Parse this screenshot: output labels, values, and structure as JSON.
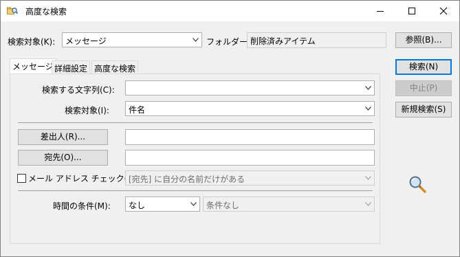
{
  "window": {
    "title": "高度な検索",
    "controls": {
      "minimize": "minimize",
      "maximize": "maximize",
      "close": "close"
    }
  },
  "top": {
    "search_target_label": "検索対象(K):",
    "search_target_value": "メッセージ",
    "folder_label": "フォルダー:",
    "folder_value": "削除済みアイテム",
    "browse_button": "参照(B)..."
  },
  "tabs": [
    {
      "label": "メッセージ",
      "active": true
    },
    {
      "label": "詳細設定",
      "active": false
    },
    {
      "label": "高度な検索",
      "active": false
    }
  ],
  "form": {
    "search_text_label": "検索する文字列(C):",
    "search_text_value": "",
    "search_in_label": "検索対象(I):",
    "search_in_value": "件名",
    "from_button": "差出人(R)...",
    "from_value": "",
    "to_button": "宛先(O)...",
    "to_value": "",
    "mail_address_check_label": "メール アドレス チェック(W):",
    "mail_address_check_checked": false,
    "mail_address_check_value": "[宛先] に自分の名前だけがある",
    "time_label": "時間の条件(M):",
    "time_value": "なし",
    "time_condition_value": "条件なし"
  },
  "actions": {
    "search": "検索(N)",
    "stop": "中止(P)",
    "new_search": "新規検索(S)"
  },
  "icons": {
    "app": "search-folder-icon",
    "magnifier": "magnifier-icon"
  }
}
